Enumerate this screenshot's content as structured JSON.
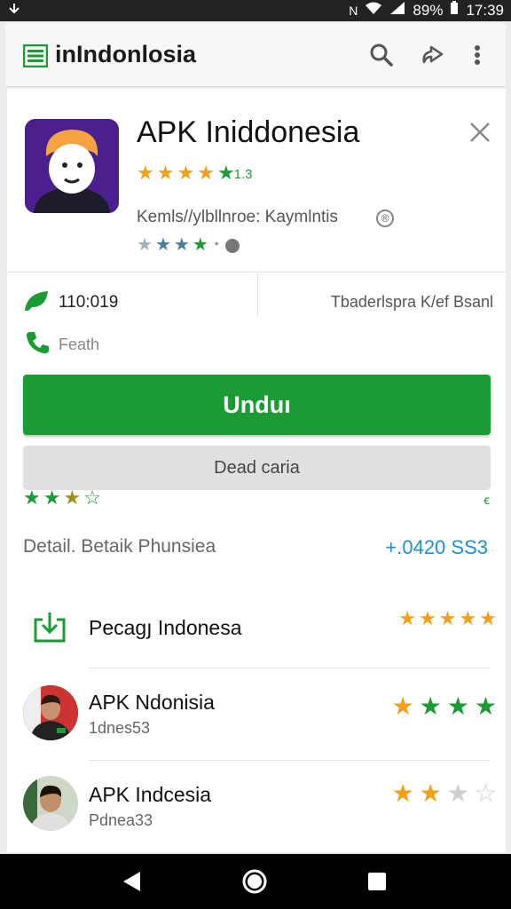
{
  "status_bar": {
    "left_icon": "download-arrow-icon",
    "battery": "89%",
    "time": "17:39"
  },
  "app_bar": {
    "brand": "inIndonlosia"
  },
  "app": {
    "title": "APK Iniddonesia",
    "rating_suffix": "1.3",
    "developer": "Kemls//ylbllnroe: Kaymlntis",
    "info_badge": "®"
  },
  "info": {
    "left_value": "110:019",
    "right_label": "Tbaderlspra K/ef Bsanl",
    "phone_label": "Feath"
  },
  "actions": {
    "install": "Unduı",
    "secondary": "Dead caria"
  },
  "rating_row": {
    "right_text": "ꞓ"
  },
  "details": {
    "label": "Detail. Betaik Phunsiea",
    "value": "+.0420 SS3"
  },
  "list": [
    {
      "title": "Pecagյ Indonesa",
      "subtitle": "",
      "icon": "download-box-icon"
    },
    {
      "title": "APK Ndonisia",
      "subtitle": "1dnes53",
      "icon": "avatar"
    },
    {
      "title": "APK Indcesia",
      "subtitle": "Pdnea33",
      "icon": "avatar"
    }
  ],
  "colors": {
    "green": "#1a9b34",
    "star_gold": "#f0a01a",
    "link_blue": "#1c8fd6"
  }
}
